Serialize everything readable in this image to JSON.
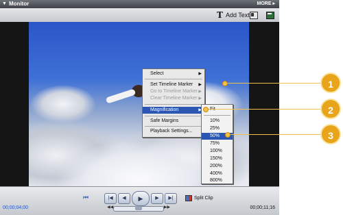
{
  "titlebar": {
    "title": "Monitor",
    "more": "MORE ▸"
  },
  "toolbar": {
    "add_text": "Add Text",
    "icons": [
      "frame-icon",
      "safe-area-icon"
    ]
  },
  "timecode": {
    "current": "00;00;04;00",
    "duration": "00;00;11;16"
  },
  "split_clip": "Split Clip",
  "context_menu": {
    "items": [
      {
        "label": "Select",
        "submenu": true,
        "disabled": false
      },
      {
        "label": "Set Timeline Marker",
        "submenu": true,
        "disabled": false
      },
      {
        "label": "Go to Timeline Marker",
        "submenu": true,
        "disabled": true
      },
      {
        "label": "Clear Timeline Marker",
        "submenu": true,
        "disabled": true
      },
      {
        "label": "Magnification",
        "submenu": true,
        "disabled": false,
        "selected": true
      },
      {
        "label": "Safe Margins",
        "submenu": false,
        "disabled": false
      },
      {
        "label": "Playback Settings...",
        "submenu": false,
        "disabled": false
      }
    ]
  },
  "magnification_menu": {
    "items": [
      "Fit",
      "10%",
      "25%",
      "50%",
      "75%",
      "100%",
      "150%",
      "200%",
      "400%",
      "800%"
    ],
    "checked": "Fit",
    "highlighted": "50%"
  },
  "callouts": [
    "1",
    "2",
    "3"
  ],
  "colors": {
    "menu_highlight": "#2b57b3",
    "callout": "#e8a51b"
  }
}
